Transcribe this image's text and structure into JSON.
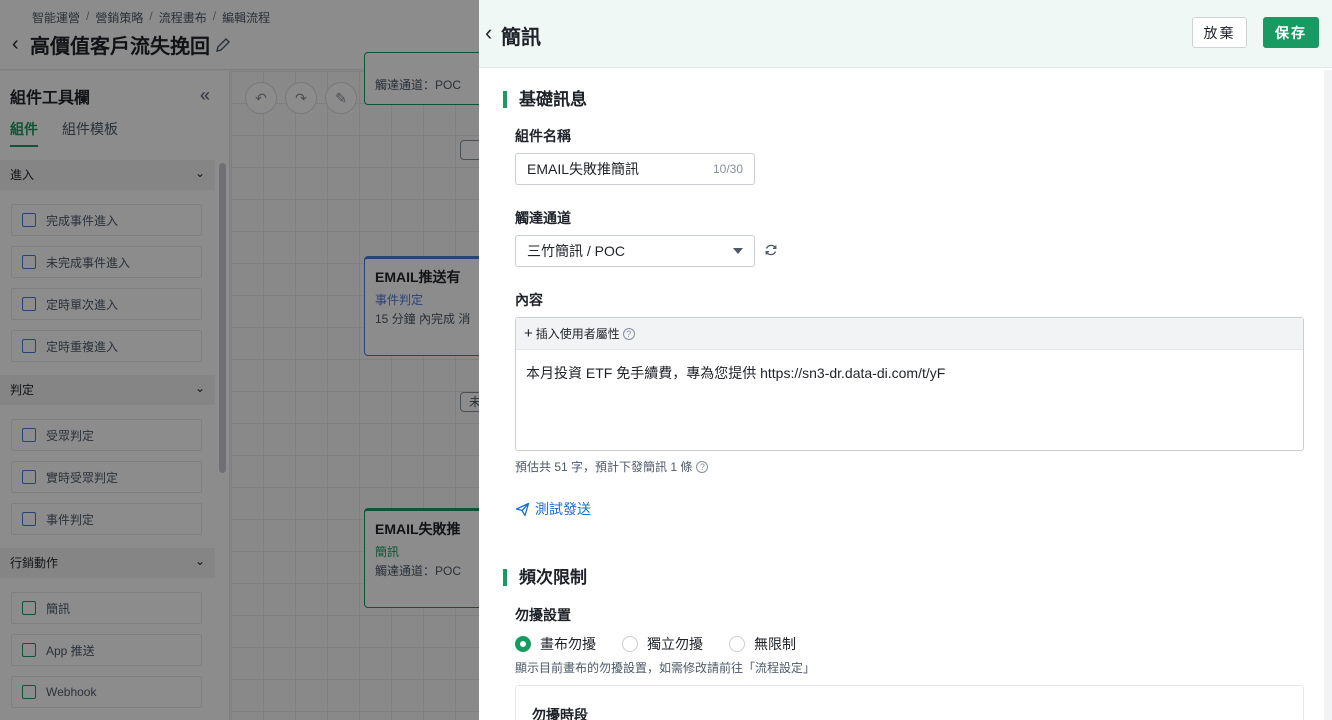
{
  "background": {
    "breadcrumb": [
      "智能運營",
      "營銷策略",
      "流程畫布",
      "編輯流程"
    ],
    "page_title": "高價值客戶流失挽回",
    "toolbox": {
      "title": "組件工具欄",
      "tabs": [
        "組件",
        "組件模板"
      ],
      "groups": [
        {
          "label": "進入",
          "items": [
            "完成事件進入",
            "未完成事件進入",
            "定時單次進入",
            "定時重複進入"
          ]
        },
        {
          "label": "判定",
          "items": [
            "受眾判定",
            "實時受眾判定",
            "事件判定"
          ]
        },
        {
          "label": "行銷動作",
          "items": [
            "簡訊",
            "App 推送",
            "Webhook"
          ]
        }
      ]
    },
    "canvas": {
      "top_node_channel": "觸達通道：POC",
      "node_email_push": {
        "title": "EMAIL推送有",
        "sub": "事件判定",
        "detail": "15 分鐘 內完成 消"
      },
      "pill_label": "未",
      "node_email_fail": {
        "title": "EMAIL失敗推",
        "sub": "簡訊",
        "detail": "觸達通道：POC"
      }
    }
  },
  "drawer": {
    "title": "簡訊",
    "discard_label": "放棄",
    "save_label": "保存",
    "basic_section": "基礎訊息",
    "name_label": "組件名稱",
    "name_value": "EMAIL失敗推簡訊",
    "name_count": "10/30",
    "channel_label": "觸達通道",
    "channel_value": "三竹簡訊 / POC",
    "content_label": "內容",
    "insert_attr_label": "插入使用者屬性",
    "content_text": "本月投資 ETF 免手續費，專為您提供 https://sn3-dr.data-di.com/t/yF",
    "estimate_text": "預估共 51 字，預計下發簡訊 1 條",
    "test_send_label": "測試發送",
    "freq_section": "頻次限制",
    "dnd_label": "勿擾設置",
    "dnd_options": [
      "畫布勿擾",
      "獨立勿擾",
      "無限制"
    ],
    "dnd_selected": "畫布勿擾",
    "dnd_hint": "顯示目前畫布的勿擾設置，如需修改請前往「流程設定」",
    "dnd_period_label": "勿擾時段"
  },
  "colors": {
    "accent": "#1a9a63",
    "link": "#1a6fd6",
    "header_bg": "#f0f8f6"
  }
}
